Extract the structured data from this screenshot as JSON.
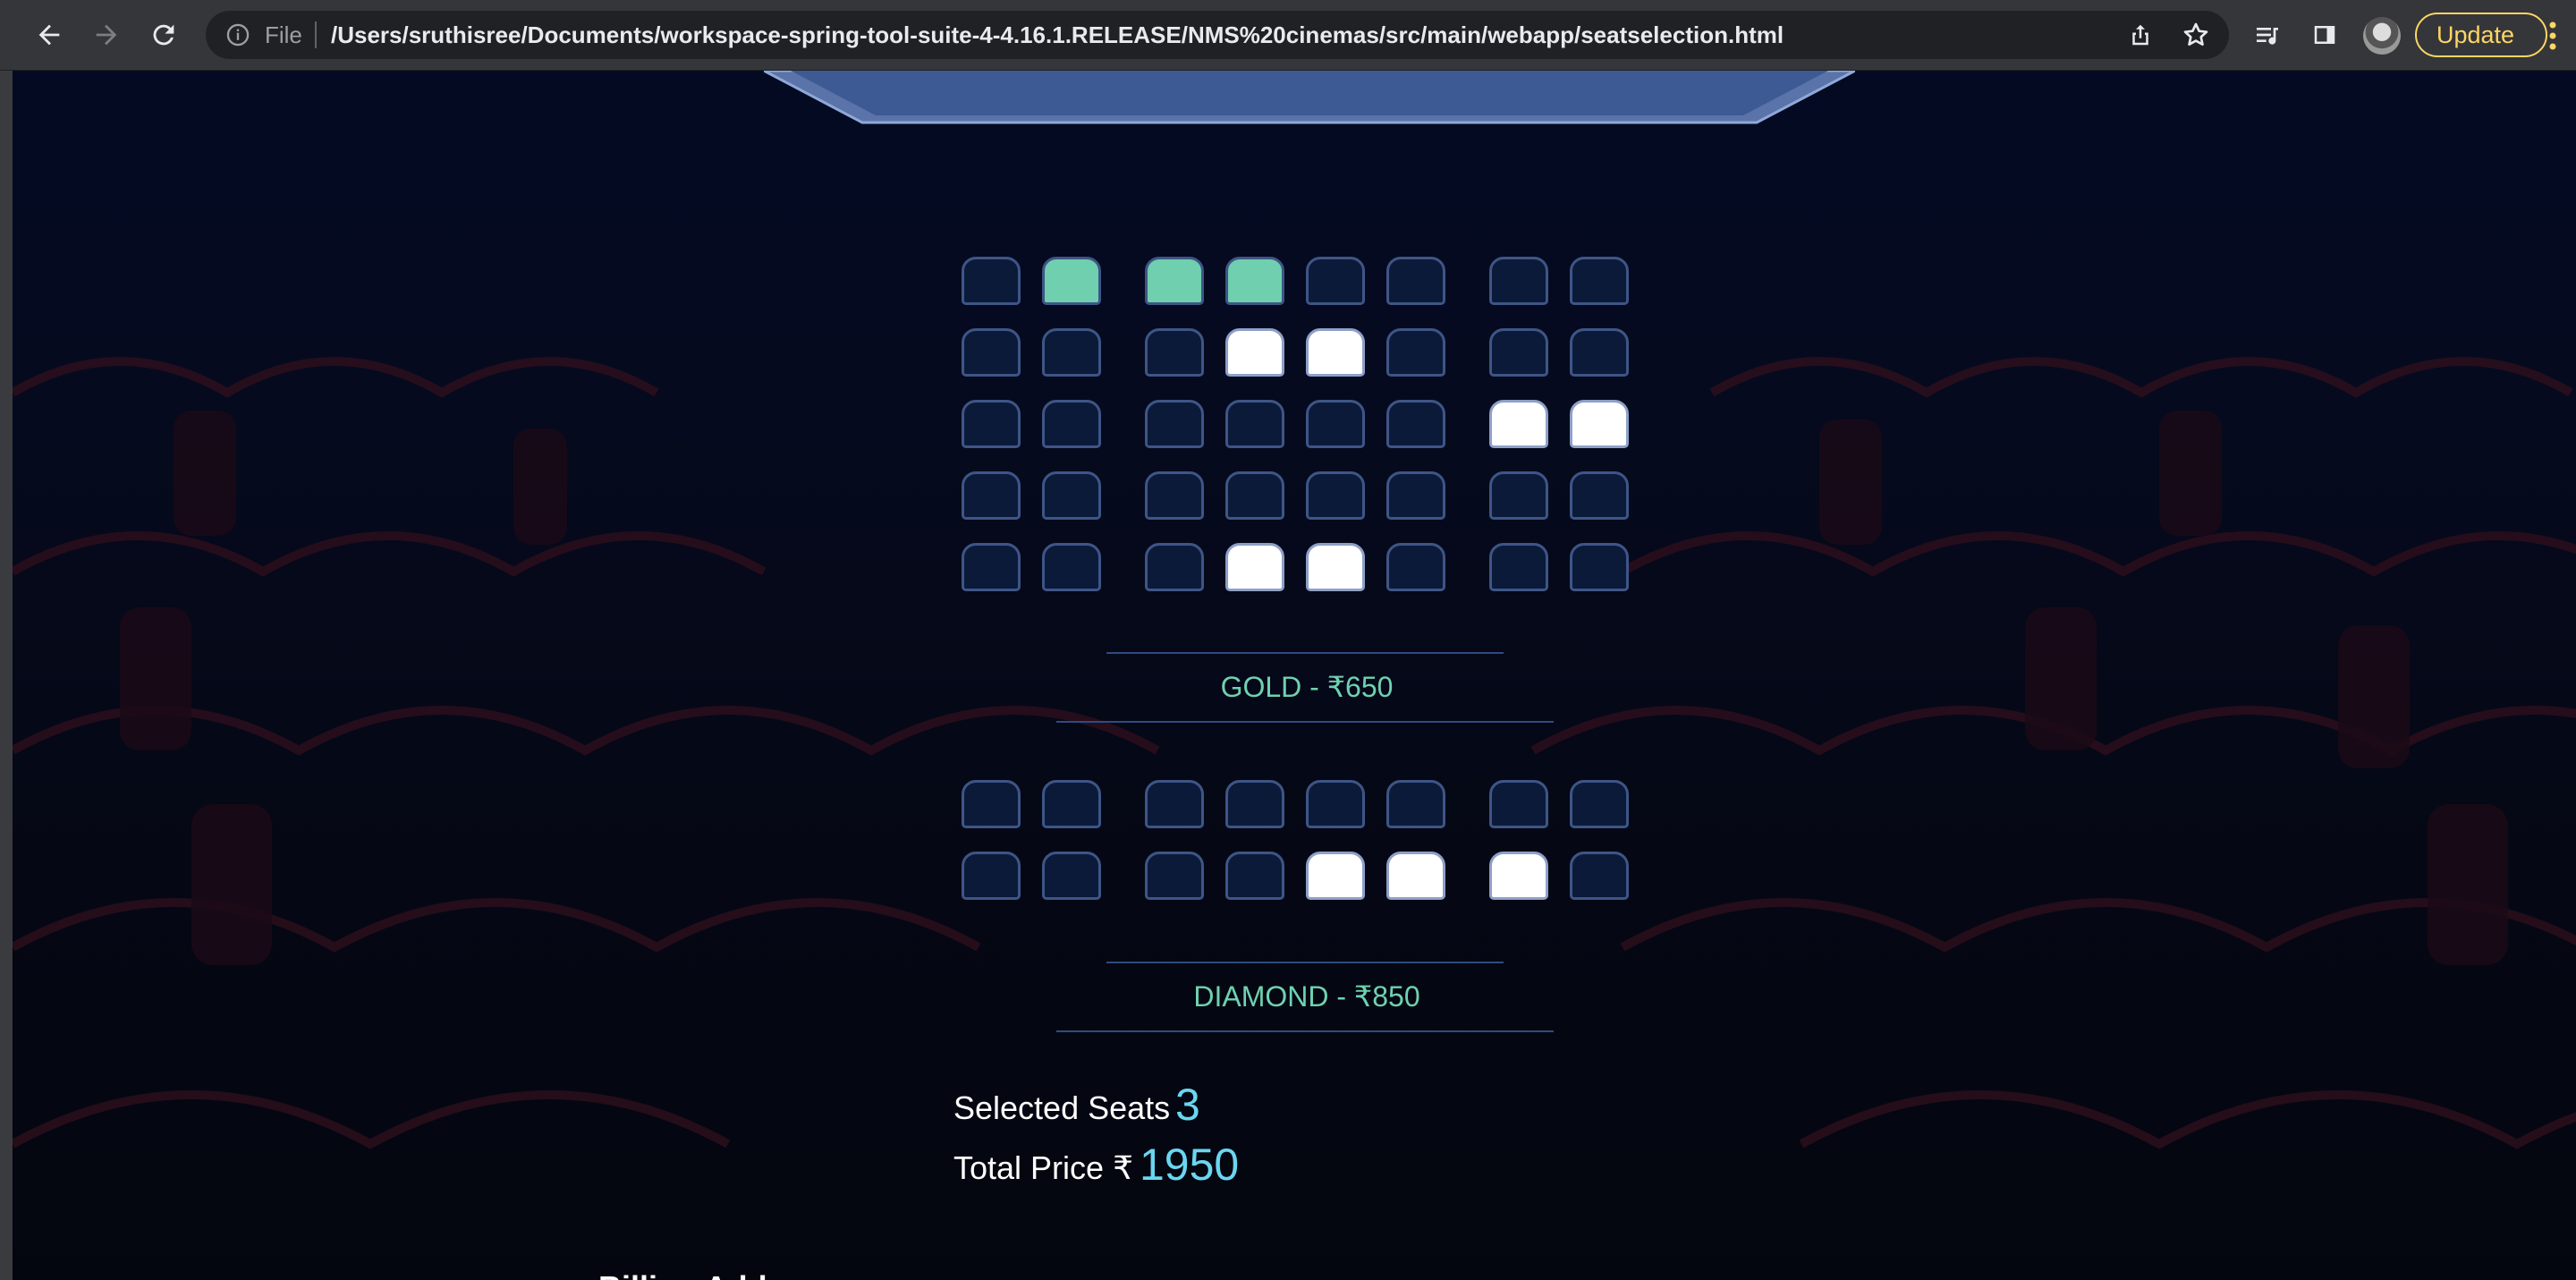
{
  "browser": {
    "back_icon": "arrow-left-icon",
    "forward_icon": "arrow-right-icon",
    "reload_icon": "reload-icon",
    "site_info_icon": "info-icon",
    "scheme_label": "File",
    "url": "/Users/sruthisree/Documents/workspace-spring-tool-suite-4-4.16.1.RELEASE/NMS%20cinemas/src/main/webapp/seatselection.html",
    "share_icon": "share-icon",
    "bookmark_icon": "star-icon",
    "reading_list_icon": "media-list-icon",
    "side_panel_icon": "side-panel-icon",
    "update_label": "Update",
    "menu_icon": "more-vertical-icon"
  },
  "colors": {
    "seat_available": "#0c1a3a",
    "seat_occupied": "#ffffff",
    "seat_selected": "#6fcfae",
    "accent_text": "#6fd1b0",
    "value_text": "#6ad6f0"
  },
  "gold_section": {
    "label": "GOLD - ₹650",
    "rows": [
      [
        "available",
        "selected",
        "selected",
        "selected",
        "available",
        "available",
        "available",
        "available"
      ],
      [
        "available",
        "available",
        "available",
        "occupied",
        "occupied",
        "available",
        "available",
        "available"
      ],
      [
        "available",
        "available",
        "available",
        "available",
        "available",
        "available",
        "occupied",
        "occupied"
      ],
      [
        "available",
        "available",
        "available",
        "available",
        "available",
        "available",
        "available",
        "available"
      ],
      [
        "available",
        "available",
        "available",
        "occupied",
        "occupied",
        "available",
        "available",
        "available"
      ]
    ]
  },
  "diamond_section": {
    "label": "DIAMOND - ₹850",
    "rows": [
      [
        "available",
        "available",
        "available",
        "available",
        "available",
        "available",
        "available",
        "available"
      ],
      [
        "available",
        "available",
        "available",
        "available",
        "occupied",
        "occupied",
        "occupied",
        "available"
      ]
    ]
  },
  "summary": {
    "selected_seats_label": "Selected Seats",
    "selected_seats_count": "3",
    "total_price_label": "Total Price ₹",
    "total_price_value": "1950"
  },
  "billing": {
    "heading_partial": "Billing Address"
  }
}
